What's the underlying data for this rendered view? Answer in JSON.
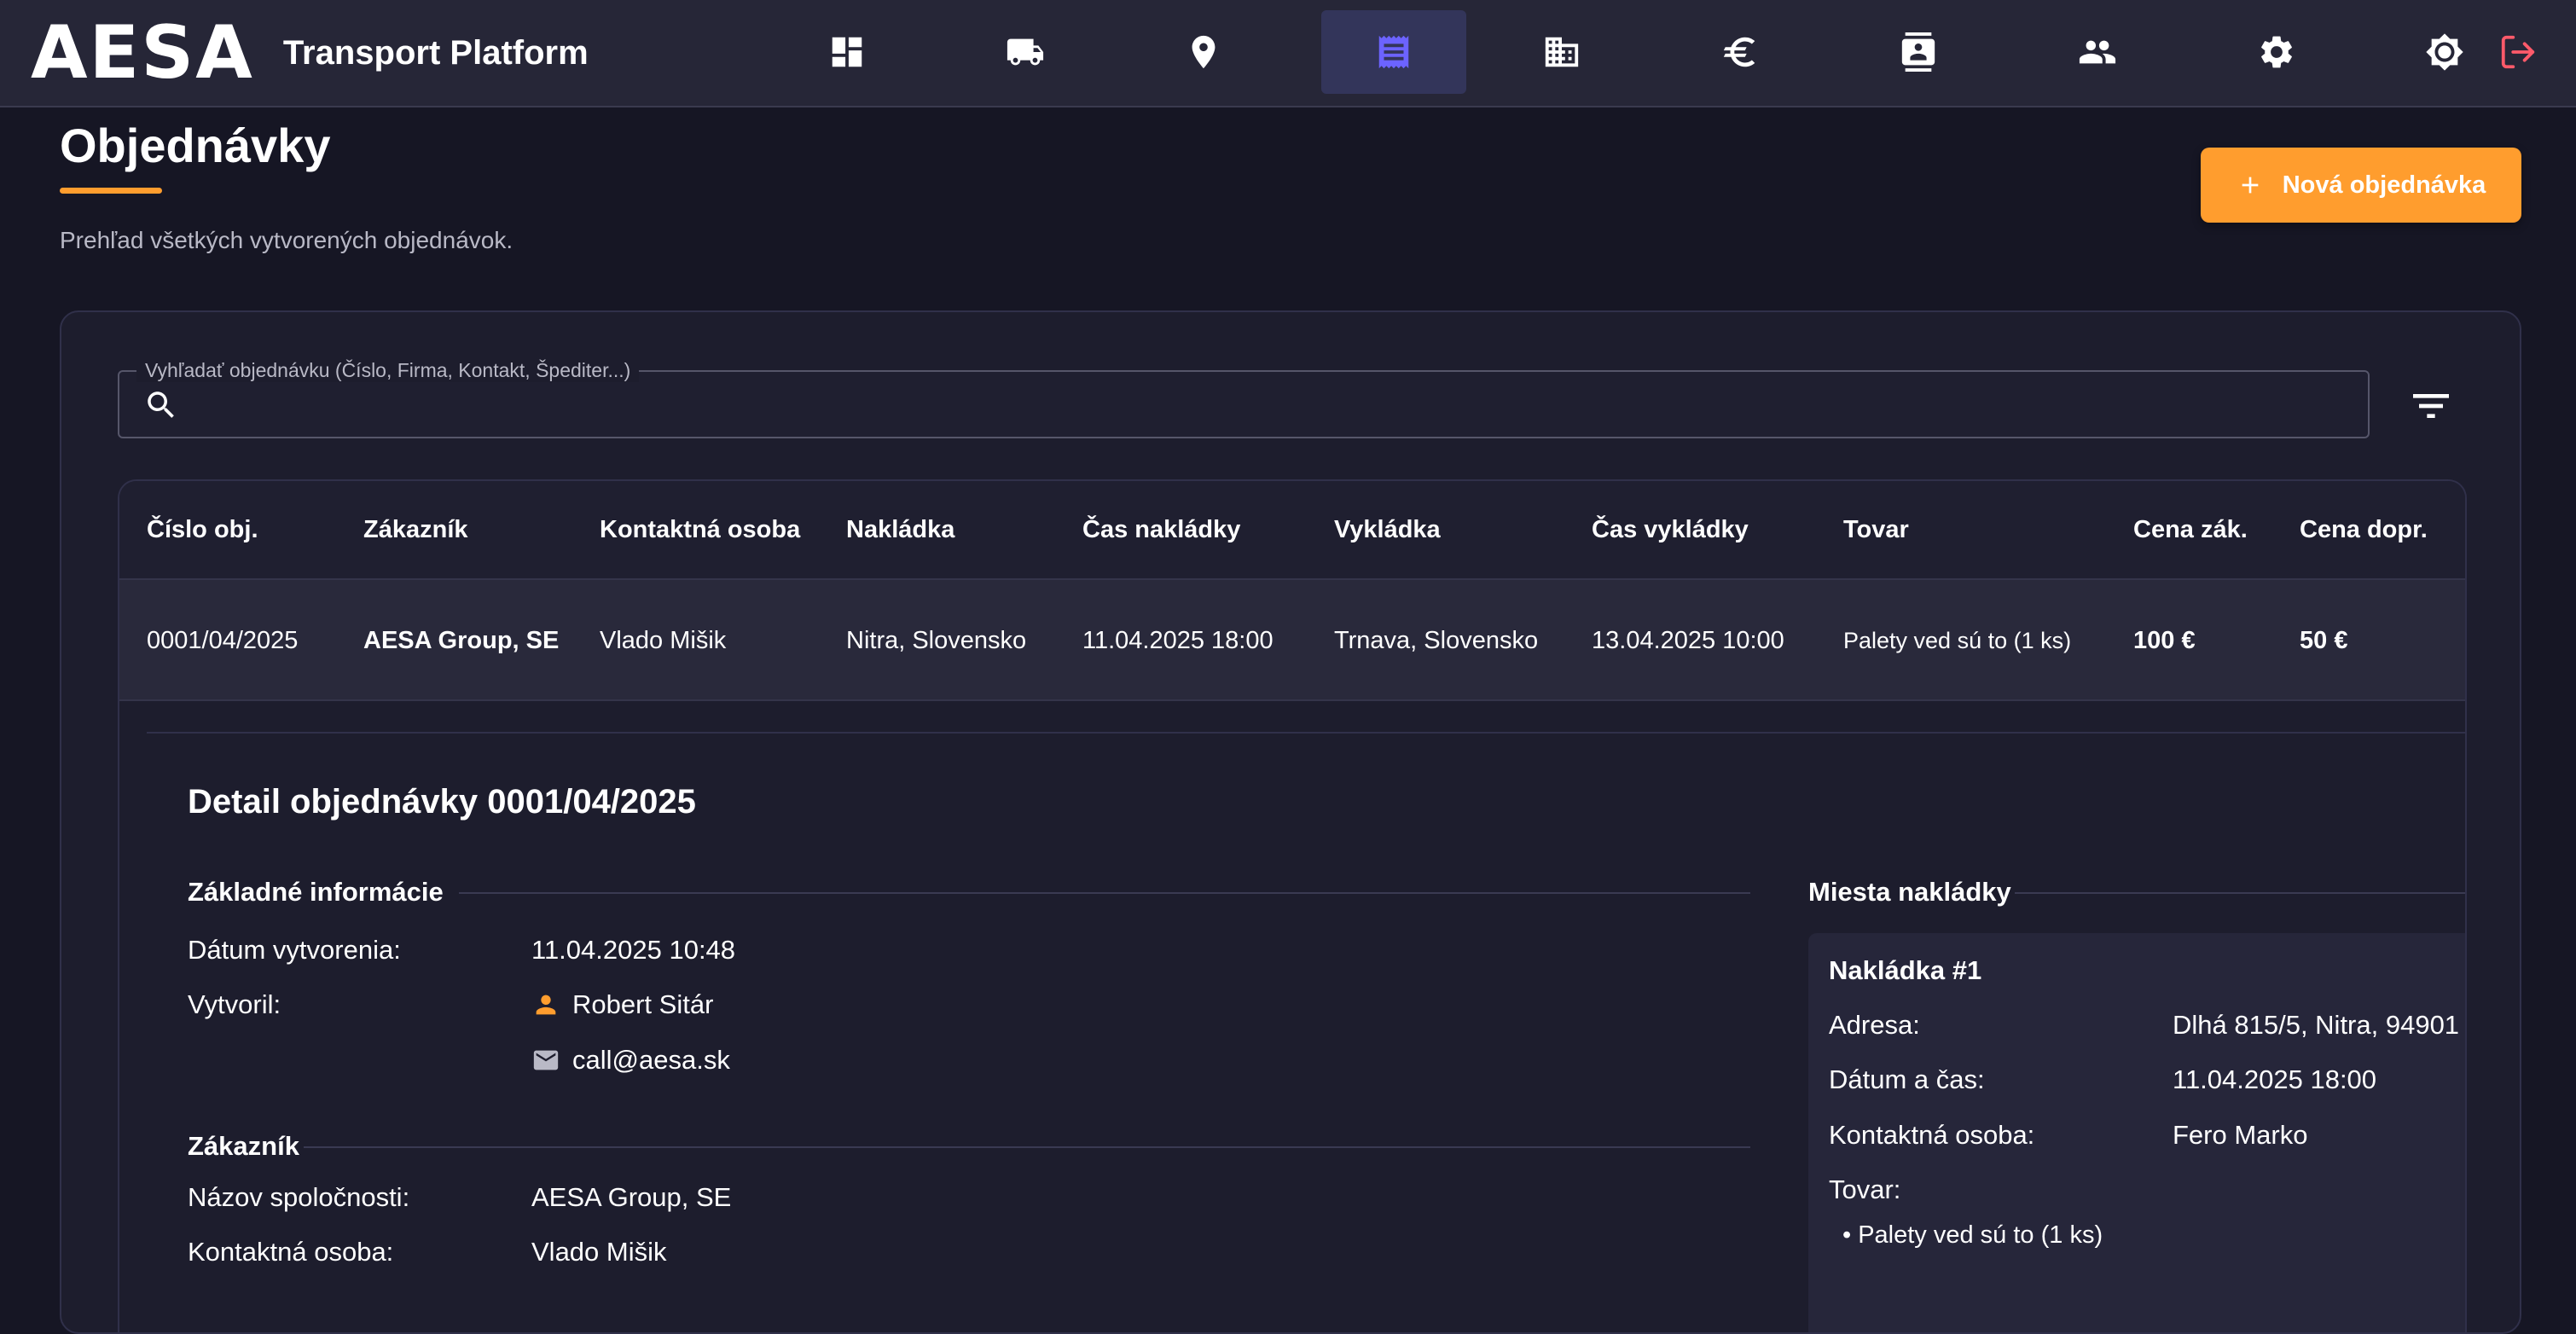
{
  "app": {
    "logo_text": "AESA",
    "name": "Transport Platform"
  },
  "nav": {
    "items": [
      {
        "icon": "dashboard-icon"
      },
      {
        "icon": "truck-icon"
      },
      {
        "icon": "location-pin-icon"
      },
      {
        "icon": "orders-receipt-icon",
        "active": true
      },
      {
        "icon": "company-building-icon"
      },
      {
        "icon": "euro-icon"
      },
      {
        "icon": "contacts-icon"
      },
      {
        "icon": "users-icon"
      },
      {
        "icon": "settings-gear-icon"
      }
    ],
    "theme_icon": "theme-toggle-icon",
    "logout_icon": "logout-icon",
    "accent_color": "#6c63ff",
    "logout_color": "#ff5a6a"
  },
  "page": {
    "title": "Objednávky",
    "subtitle": "Prehľad všetkých vytvorených objednávok.",
    "new_order_label": "Nová objednávka",
    "accent_color": "#ff9d2e"
  },
  "search": {
    "label": "Vyhľadať objednávku (Číslo, Firma, Kontakt, Špediter...)",
    "value": ""
  },
  "table": {
    "columns": [
      "Číslo obj.",
      "Zákazník",
      "Kontaktná osoba",
      "Nakládka",
      "Čas nakládky",
      "Vykládka",
      "Čas vykládky",
      "Tovar",
      "Cena zák.",
      "Cena dopr."
    ],
    "rows": [
      {
        "cislo": "0001/04/2025",
        "zakaznik": "AESA Group, SE",
        "kontakt": "Vlado Mišik",
        "nakladka": "Nitra, Slovensko",
        "cas_nakladky": "11.04.2025 18:00",
        "vykladka": "Trnava, Slovensko",
        "cas_vykladky": "13.04.2025 10:00",
        "tovar": "Palety ved sú to (1 ks)",
        "cena_zak": "100 €",
        "cena_dopr": "50 €"
      }
    ]
  },
  "detail": {
    "title": "Detail objednávky 0001/04/2025",
    "basic": {
      "heading": "Základné informácie",
      "created_label": "Dátum vytvorenia:",
      "created_value": "11.04.2025 10:48",
      "creator_label": "Vytvoril:",
      "creator_name": "Robert Sitár",
      "creator_email": "call@aesa.sk"
    },
    "customer": {
      "heading": "Zákazník",
      "company_label": "Názov spoločnosti:",
      "company_value": "AESA Group, SE",
      "contact_label": "Kontaktná osoba:",
      "contact_value": "Vlado Mišik"
    },
    "loading": {
      "heading": "Miesta nakládky",
      "card_title": "Nakládka #1",
      "address_label": "Adresa:",
      "address_value": "Dlhá 815/5, Nitra, 94901",
      "datetime_label": "Dátum a čas:",
      "datetime_value": "11.04.2025 18:00",
      "contact_label": "Kontaktná osoba:",
      "contact_value": "Fero Marko",
      "goods_label": "Tovar:",
      "goods_item": "• Palety ved sú to (1 ks)"
    }
  }
}
